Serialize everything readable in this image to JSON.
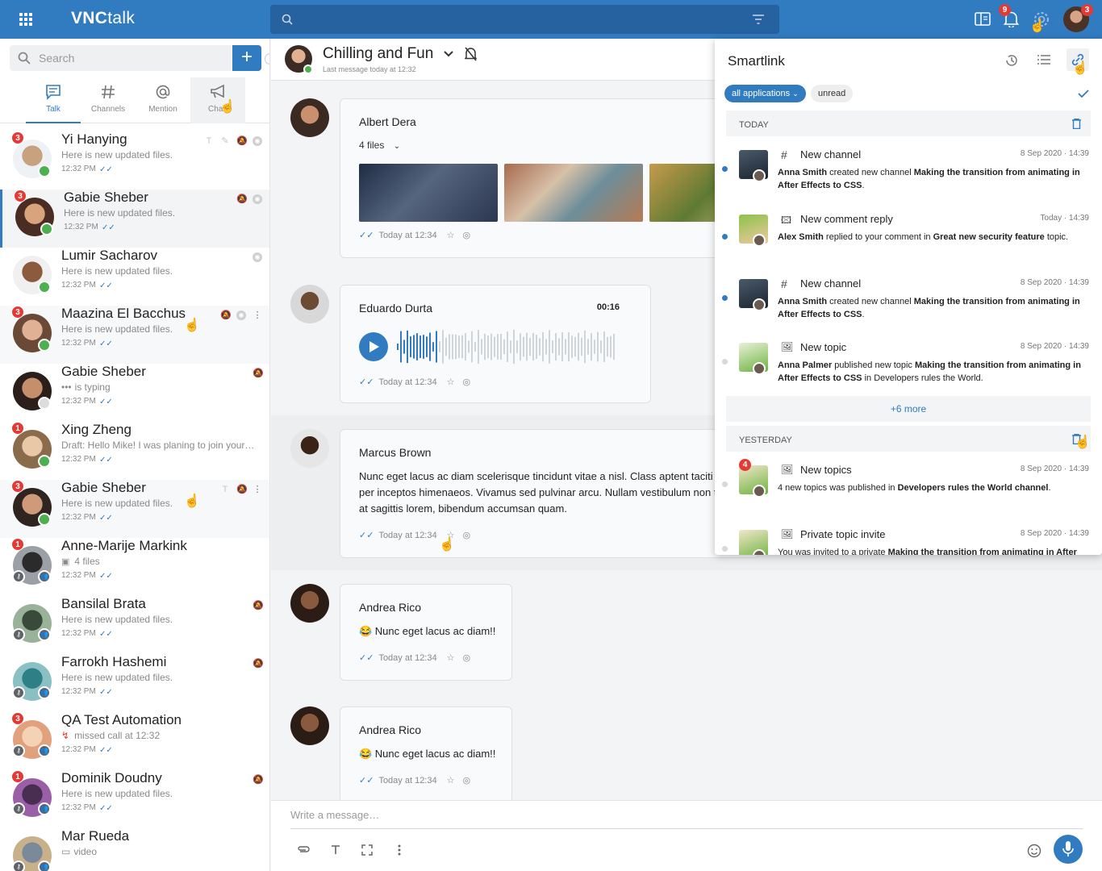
{
  "app": {
    "logo_bold": "VNC",
    "logo_light": "talk",
    "notif_count": "9",
    "avatar_count": "3"
  },
  "sidebar": {
    "search_placeholder": "Search",
    "add_label": "+",
    "tabs": [
      {
        "label": "Talk"
      },
      {
        "label": "Channels"
      },
      {
        "label": "Mention"
      },
      {
        "label": "Chan"
      }
    ],
    "conversations": [
      {
        "name": "Yi Hanying",
        "preview": "Here is new updated files.",
        "time": "12:32 PM",
        "badge": "3"
      },
      {
        "name": "Gabie Sheber",
        "preview": "Here is new updated files.",
        "time": "12:32 PM",
        "badge": "3"
      },
      {
        "name": "Lumir Sacharov",
        "preview": "Here is new updated files.",
        "time": "12:32 PM",
        "badge": ""
      },
      {
        "name": "Maazina El Bacchus",
        "preview": "Here is new updated files.",
        "time": "12:32 PM",
        "badge": "3"
      },
      {
        "name": "Gabie Sheber",
        "preview": "is typing",
        "time": "12:32 PM",
        "badge": ""
      },
      {
        "name": "Xing Zheng",
        "preview": "Draft: Hello Mike! I was planing to join your…",
        "time": "12:32 PM",
        "badge": "1"
      },
      {
        "name": "Gabie Sheber",
        "preview": "Here is new updated files.",
        "time": "12:32 PM",
        "badge": "3"
      },
      {
        "name": "Anne-Marije Markink",
        "preview": "4 files",
        "time": "12:32 PM",
        "badge": "1"
      },
      {
        "name": "Bansilal Brata",
        "preview": "Here is new updated files.",
        "time": "12:32 PM",
        "badge": ""
      },
      {
        "name": "Farrokh Hashemi",
        "preview": "Here is new updated files.",
        "time": "12:32 PM",
        "badge": ""
      },
      {
        "name": "QA Test Automation",
        "preview": "missed call at 12:32",
        "time": "12:32 PM",
        "badge": "3"
      },
      {
        "name": "Dominik Doudny",
        "preview": "Here is new updated files.",
        "time": "12:32 PM",
        "badge": "1"
      },
      {
        "name": "Mar Rueda",
        "preview": "video",
        "time": "",
        "badge": ""
      }
    ]
  },
  "chat": {
    "title": "Chilling and Fun",
    "subtitle": "Last message today at 12:32",
    "messages": [
      {
        "author": "Albert Dera",
        "files_label": "4 files",
        "meta": "Today at 12:34"
      },
      {
        "author": "Eduardo Durta",
        "duration": "00:16",
        "meta": "Today at 12:34"
      },
      {
        "author": "Marcus Brown",
        "text": "Nunc eget lacus ac diam scelerisque tincidunt vitae a nisl. Class aptent taciti so per inceptos himenaeos. Vivamus sed pulvinar arcu. Nullam vestibulum non te at sagittis lorem, bibendum accumsan quam.",
        "meta": "Today at 12:34"
      },
      {
        "author": "Andrea Rico",
        "text": "😂 Nunc eget lacus ac diam!!",
        "meta": "Today at 12:34"
      },
      {
        "author": "Andrea Rico",
        "text": "😂 Nunc eget lacus ac diam!!",
        "meta": "Today at 12:34"
      }
    ],
    "composer_placeholder": "Write a message…"
  },
  "smartlink": {
    "title": "Smartlink",
    "filter_all": "all applications",
    "filter_unread": "unread",
    "today_label": "TODAY",
    "yesterday_label": "YESTERDAY",
    "more_label": "+6 more",
    "today": [
      {
        "type": "New channel",
        "date": "8 Sep 2020 · 14:39",
        "actor": "Anna Smith",
        "mid": " created new channel ",
        "obj": "Making the transition from animating in After Effects to CSS",
        "tail": "."
      },
      {
        "type": "New comment reply",
        "date": "Today · 14:39",
        "actor": "Alex Smith",
        "mid": " replied to your comment in ",
        "obj": "Great new security feature",
        "tail": " topic."
      },
      {
        "type": "New channel",
        "date": "8 Sep 2020 · 14:39",
        "actor": "Anna Smith",
        "mid": " created new channel ",
        "obj": "Making the transition from animating in After Effects to CSS",
        "tail": "."
      },
      {
        "type": "New topic",
        "date": "8 Sep 2020 · 14:39",
        "actor": "Anna Palmer",
        "mid": " published new topic ",
        "obj": "Making the transition from animating in After Effects to CSS",
        "tail": " in Developers rules the World."
      }
    ],
    "yesterday": [
      {
        "type": "New topics",
        "date": "8 Sep 2020 · 14:39",
        "badge": "4",
        "actor": "4 new topics was published in ",
        "obj": "Developers rules the World channel",
        "tail": "."
      },
      {
        "type": "Private topic invite",
        "date": "8 Sep 2020 · 14:39",
        "actor": "You was invited to a private ",
        "obj": "Making the transition from animating in After",
        "tail": ""
      }
    ]
  },
  "colors": {
    "primary": "#317bc1",
    "badge": "#e53935",
    "online": "#4caf50"
  }
}
